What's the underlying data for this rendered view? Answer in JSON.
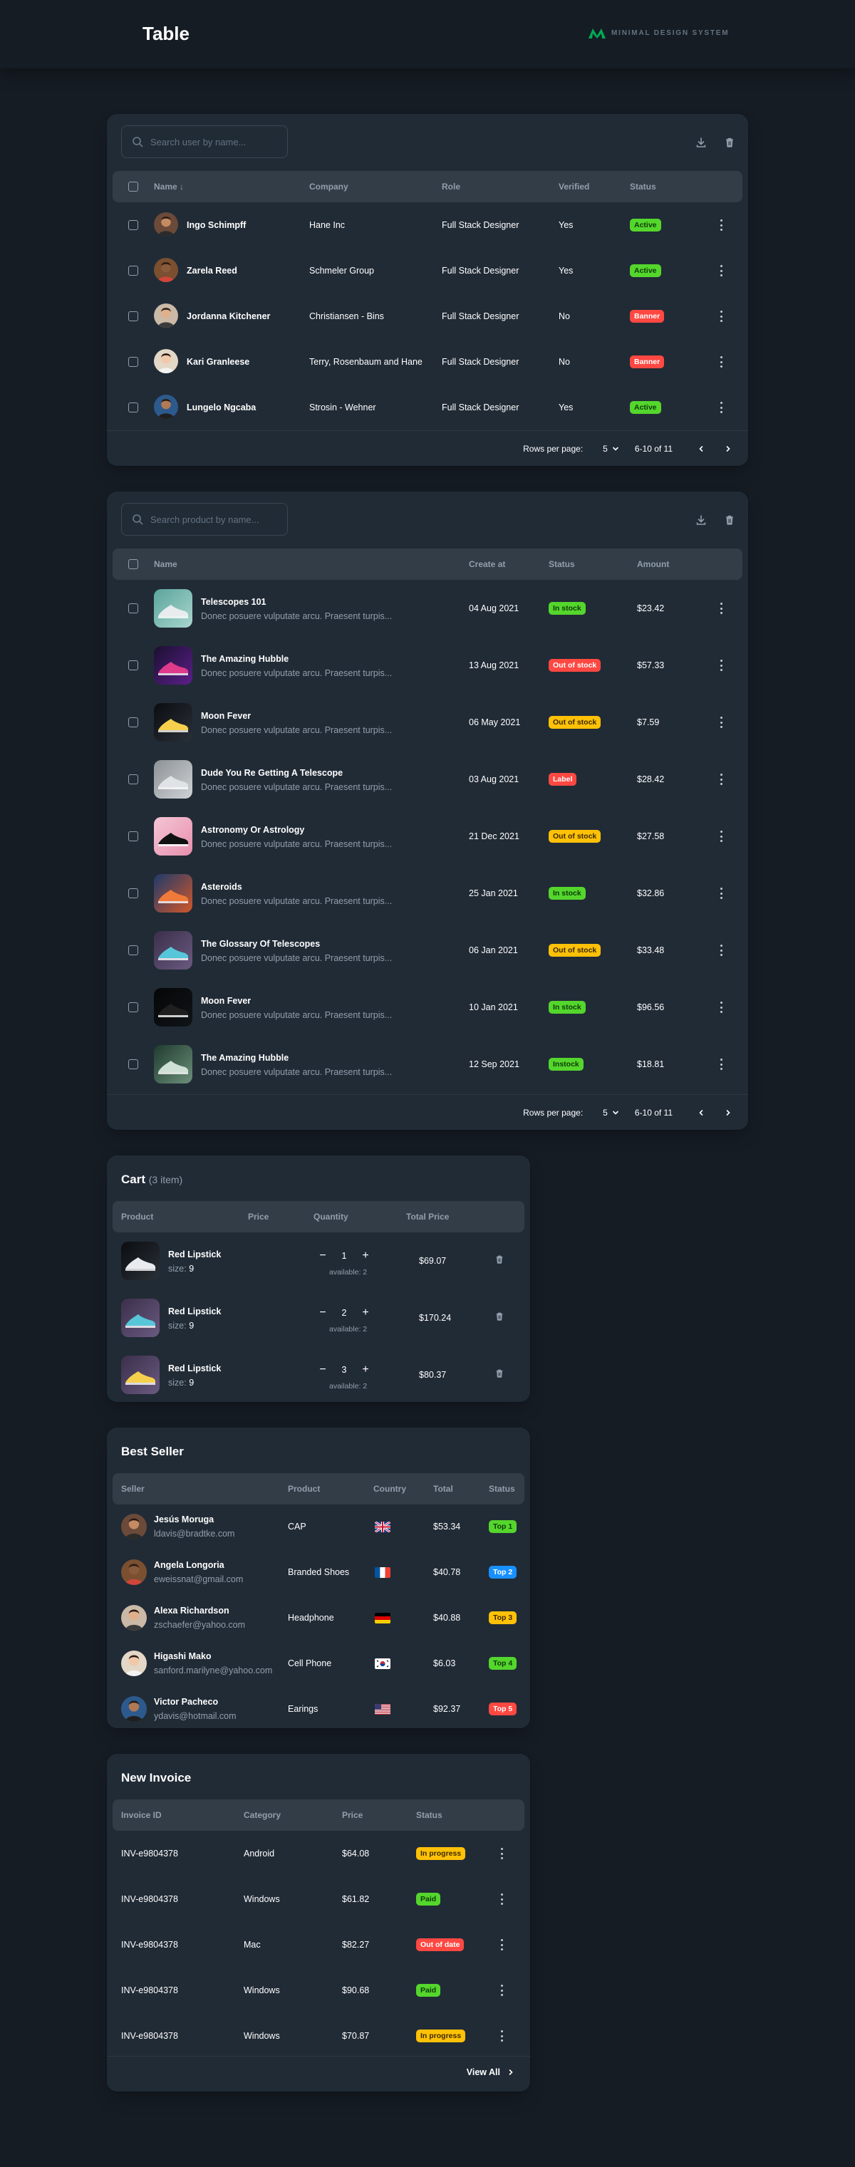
{
  "header": {
    "title": "Table",
    "brand": "MINIMAL DESIGN SYSTEM"
  },
  "colors": {
    "background": "#161c24",
    "card": "#212b36",
    "header_row": "#333d48",
    "green": "#54d62c",
    "red": "#ff4842",
    "yellow": "#ffc107",
    "blue": "#1890ff"
  },
  "users_table": {
    "search_placeholder": "Search user by name...",
    "columns": {
      "name": "Name",
      "company": "Company",
      "role": "Role",
      "verified": "Verified",
      "status": "Status"
    },
    "rows": [
      {
        "name": "Ingo Schimpff",
        "company": "Hane Inc",
        "role": "Full Stack Designer",
        "verified": "Yes",
        "status": "Active",
        "status_color": "#54d62c"
      },
      {
        "name": "Zarela Reed",
        "company": "Schmeler Group",
        "role": "Full Stack Designer",
        "verified": "Yes",
        "status": "Active",
        "status_color": "#54d62c"
      },
      {
        "name": "Jordanna Kitchener",
        "company": "Christiansen - Bins",
        "role": "Full Stack Designer",
        "verified": "No",
        "status": "Banner",
        "status_color": "#ff4842"
      },
      {
        "name": "Kari Granleese",
        "company": "Terry, Rosenbaum and Hane",
        "role": "Full Stack Designer",
        "verified": "No",
        "status": "Banner",
        "status_color": "#ff4842"
      },
      {
        "name": "Lungelo Ngcaba",
        "company": "Strosin - Wehner",
        "role": "Full Stack Designer",
        "verified": "Yes",
        "status": "Active",
        "status_color": "#54d62c"
      }
    ],
    "pagination": {
      "rows_per_page_label": "Rows per page:",
      "rows_per_page": "5",
      "range": "6-10 of 11"
    }
  },
  "products_table": {
    "search_placeholder": "Search product by name...",
    "columns": {
      "name": "Name",
      "created": "Create at",
      "status": "Status",
      "amount": "Amount"
    },
    "rows": [
      {
        "name": "Telescopes 101",
        "desc": "Donec posuere vulputate arcu. Praesent turpis...",
        "created": "04 Aug 2021",
        "status": "In stock",
        "status_color": "#54d62c",
        "amount": "$23.42"
      },
      {
        "name": "The Amazing Hubble",
        "desc": "Donec posuere vulputate arcu. Praesent turpis...",
        "created": "13 Aug 2021",
        "status": "Out of stock",
        "status_color": "#ff4842",
        "amount": "$57.33"
      },
      {
        "name": "Moon Fever",
        "desc": "Donec posuere vulputate arcu. Praesent turpis...",
        "created": "06 May 2021",
        "status": "Out of stock",
        "status_color": "#ffc107",
        "amount": "$7.59"
      },
      {
        "name": "Dude You Re Getting A Telescope",
        "desc": "Donec posuere vulputate arcu. Praesent turpis...",
        "created": "03 Aug 2021",
        "status": "Label",
        "status_color": "#ff4842",
        "amount": "$28.42"
      },
      {
        "name": "Astronomy Or Astrology",
        "desc": "Donec posuere vulputate arcu. Praesent turpis...",
        "created": "21 Dec 2021",
        "status": "Out of stock",
        "status_color": "#ffc107",
        "amount": "$27.58"
      },
      {
        "name": "Asteroids",
        "desc": "Donec posuere vulputate arcu. Praesent turpis...",
        "created": "25 Jan 2021",
        "status": "In stock",
        "status_color": "#54d62c",
        "amount": "$32.86"
      },
      {
        "name": "The Glossary Of Telescopes",
        "desc": "Donec posuere vulputate arcu. Praesent turpis...",
        "created": "06 Jan 2021",
        "status": "Out of stock",
        "status_color": "#ffc107",
        "amount": "$33.48"
      },
      {
        "name": "Moon Fever",
        "desc": "Donec posuere vulputate arcu. Praesent turpis...",
        "created": "10 Jan 2021",
        "status": "In stock",
        "status_color": "#54d62c",
        "amount": "$96.56"
      },
      {
        "name": "The Amazing Hubble",
        "desc": "Donec posuere vulputate arcu. Praesent turpis...",
        "created": "12 Sep 2021",
        "status": "Instock",
        "status_color": "#54d62c",
        "amount": "$18.81"
      }
    ],
    "pagination": {
      "rows_per_page_label": "Rows per page:",
      "rows_per_page": "5",
      "range": "6-10 of 11"
    }
  },
  "cart": {
    "title": "Cart",
    "count": "(3 item)",
    "columns": {
      "product": "Product",
      "price": "Price",
      "quantity": "Quantity",
      "total": "Total Price"
    },
    "rows": [
      {
        "name": "Red Lipstick",
        "size_label": "size:",
        "size": "9",
        "qty": "1",
        "available": "available: 2",
        "total": "$69.07"
      },
      {
        "name": "Red Lipstick",
        "size_label": "size:",
        "size": "9",
        "qty": "2",
        "available": "available: 2",
        "total": "$170.24"
      },
      {
        "name": "Red Lipstick",
        "size_label": "size:",
        "size": "9",
        "qty": "3",
        "available": "available: 2",
        "total": "$80.37"
      }
    ]
  },
  "best_seller": {
    "title": "Best Seller",
    "columns": {
      "seller": "Seller",
      "product": "Product",
      "country": "Country",
      "total": "Total",
      "status": "Status"
    },
    "rows": [
      {
        "name": "Jesús Moruga",
        "email": "ldavis@bradtke.com",
        "product": "CAP",
        "country_flag": "uk-flag-icon",
        "total": "$53.34",
        "rank": "Top 1",
        "rank_color": "#54d62c"
      },
      {
        "name": "Angela Longoria",
        "email": "eweissnat@gmail.com",
        "product": "Branded Shoes",
        "country_flag": "france-flag-icon",
        "total": "$40.78",
        "rank": "Top 2",
        "rank_color": "#1890ff"
      },
      {
        "name": "Alexa Richardson",
        "email": "zschaefer@yahoo.com",
        "product": "Headphone",
        "country_flag": "germany-flag-icon",
        "total": "$40.88",
        "rank": "Top 3",
        "rank_color": "#ffc107"
      },
      {
        "name": "Higashi Mako",
        "email": "sanford.marilyne@yahoo.com",
        "product": "Cell Phone",
        "country_flag": "korea-flag-icon",
        "total": "$6.03",
        "rank": "Top 4",
        "rank_color": "#54d62c"
      },
      {
        "name": "Victor Pacheco",
        "email": "ydavis@hotmail.com",
        "product": "Earings",
        "country_flag": "usa-flag-icon",
        "total": "$92.37",
        "rank": "Top 5",
        "rank_color": "#ff4842"
      }
    ]
  },
  "invoice": {
    "title": "New Invoice",
    "columns": {
      "id": "Invoice ID",
      "category": "Category",
      "price": "Price",
      "status": "Status"
    },
    "rows": [
      {
        "id": "INV-e9804378",
        "category": "Android",
        "price": "$64.08",
        "status": "In progress",
        "status_color": "#ffc107"
      },
      {
        "id": "INV-e9804378",
        "category": "Windows",
        "price": "$61.82",
        "status": "Paid",
        "status_color": "#54d62c"
      },
      {
        "id": "INV-e9804378",
        "category": "Mac",
        "price": "$82.27",
        "status": "Out of date",
        "status_color": "#ff4842"
      },
      {
        "id": "INV-e9804378",
        "category": "Windows",
        "price": "$90.68",
        "status": "Paid",
        "status_color": "#54d62c"
      },
      {
        "id": "INV-e9804378",
        "category": "Windows",
        "price": "$70.87",
        "status": "In progress",
        "status_color": "#ffc107"
      }
    ],
    "view_all": "View All"
  }
}
